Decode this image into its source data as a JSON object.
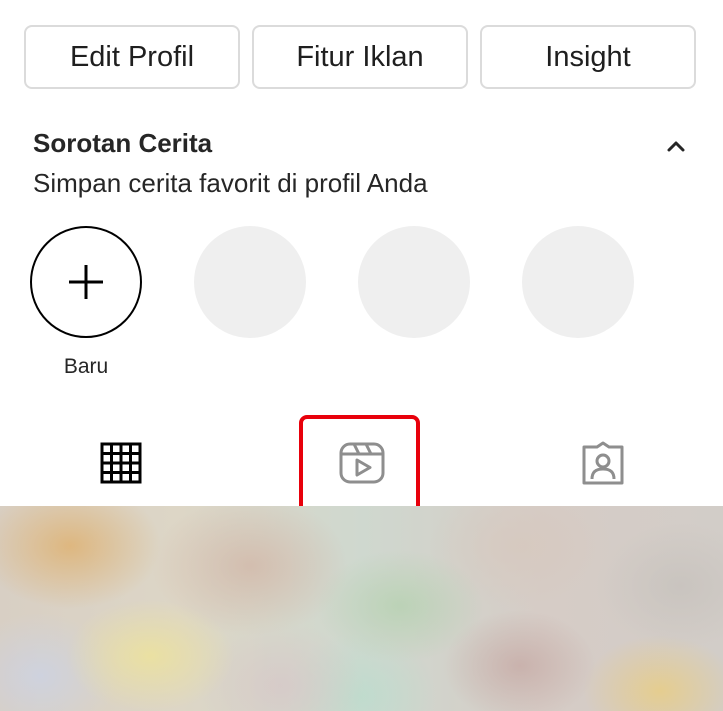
{
  "profile_actions": {
    "edit_profile": "Edit Profil",
    "ad_tools": "Fitur Iklan",
    "insights": "Insight"
  },
  "highlights": {
    "title": "Sorotan Cerita",
    "subtitle": "Simpan cerita favorit di profil Anda",
    "collapse_icon": "chevron-up-icon",
    "new_label": "Baru",
    "new_icon": "plus-icon",
    "placeholder_count": 3
  },
  "tabs": [
    {
      "name": "posts-grid",
      "icon": "grid-icon",
      "active": true
    },
    {
      "name": "reels",
      "icon": "reels-icon",
      "active": false,
      "highlighted": true
    },
    {
      "name": "tagged",
      "icon": "tagged-person-icon",
      "active": false
    }
  ],
  "colors": {
    "highlight_border": "#e8000b",
    "placeholder_fill": "#efefef",
    "inactive_icon": "#8e8e8e",
    "active_icon": "#000000"
  }
}
